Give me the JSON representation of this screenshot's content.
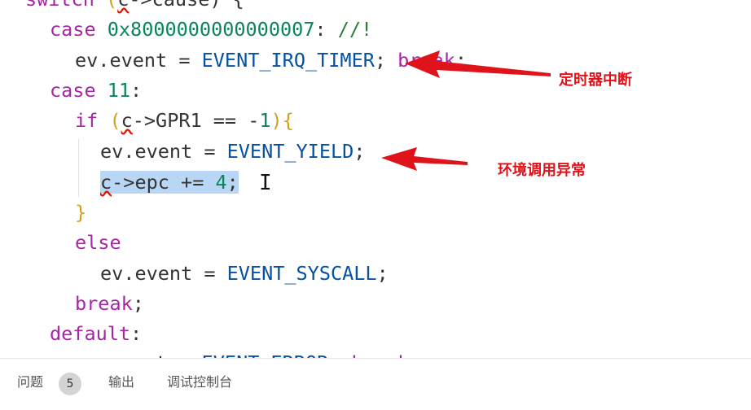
{
  "code": {
    "l0": {
      "kw": "switch",
      "mid": " (",
      "err": "c",
      "rest": "->cause) {"
    },
    "l1": {
      "kw": "case",
      "num": "0x8000000000000007",
      "pun": ":",
      "cmt": "//!"
    },
    "l2": {
      "id": "ev.event = ",
      "cst": "EVENT_IRQ_TIMER",
      "pun": "; ",
      "kw": "break",
      "end": ";"
    },
    "l3": {
      "kw": "case",
      "num": "11",
      "pun": ":"
    },
    "l4": {
      "kw": "if",
      "open": " (",
      "err": "c",
      "mid": "->GPR1 == -",
      "num": "1",
      "close": "){"
    },
    "l5": {
      "id": "ev.event = ",
      "cst": "EVENT_YIELD",
      "pun": ";"
    },
    "l6": {
      "err": "c",
      "mid": "->epc += ",
      "num": "4",
      "end": ";"
    },
    "l7": {
      "brace": "}"
    },
    "l8": {
      "kw": "else"
    },
    "l9": {
      "id": "ev.event = ",
      "cst": "EVENT_SYSCALL",
      "pun": ";"
    },
    "l10": {
      "kw": "break",
      "pun": ";"
    },
    "l11": {
      "kw": "default",
      "pun": ":"
    },
    "l12": {
      "id": "ev.event = ",
      "cst": "EVENT_ERROR",
      "pun": "; ",
      "kw": "break",
      "end": ";"
    }
  },
  "annotations": {
    "timer": "定时器中断",
    "yield": "环境调用异常"
  },
  "colors": {
    "annotation": "#e0121a",
    "keyword": "#a626a4",
    "constant": "#0451a5",
    "number": "#098658",
    "selection": "#b9d6f5"
  },
  "panel": {
    "problems_label": "问题",
    "problems_count": "5",
    "output_label": "输出",
    "debug_console_label": "调试控制台"
  },
  "cursor_glyph": "I"
}
